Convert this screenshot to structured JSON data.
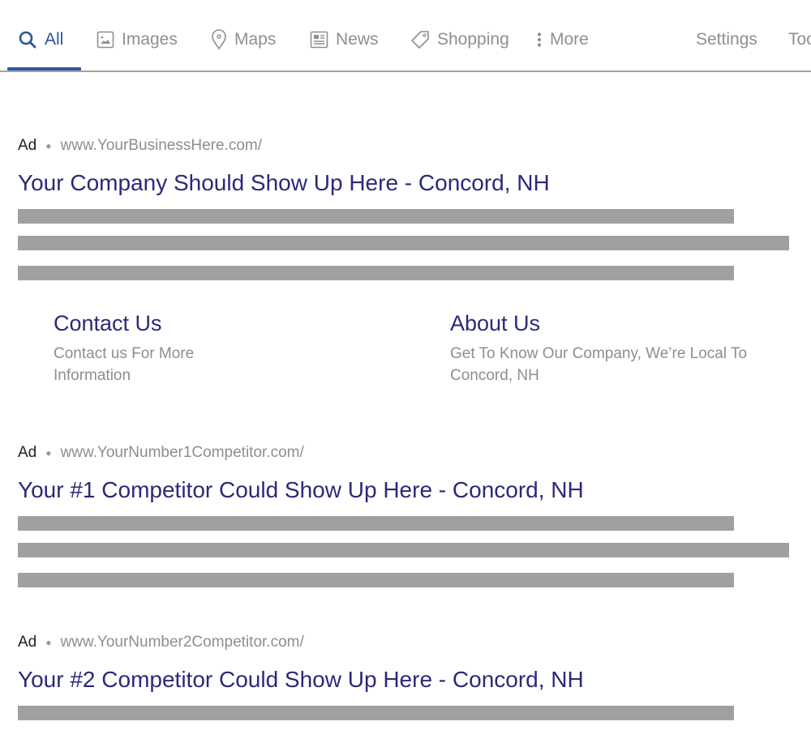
{
  "tabs": [
    {
      "id": "all",
      "label": "All",
      "icon": "search-icon",
      "active": true
    },
    {
      "id": "images",
      "label": "Images",
      "icon": "image-icon",
      "active": false
    },
    {
      "id": "maps",
      "label": "Maps",
      "icon": "map-pin-icon",
      "active": false
    },
    {
      "id": "news",
      "label": "News",
      "icon": "newspaper-icon",
      "active": false
    },
    {
      "id": "shopping",
      "label": "Shopping",
      "icon": "tag-icon",
      "active": false
    },
    {
      "id": "more",
      "label": "More",
      "icon": "more-vertical-icon",
      "active": false
    }
  ],
  "right_links": {
    "settings": "Settings",
    "tools": "Tools"
  },
  "colors": {
    "active_tab": "#2a5594",
    "ad_title": "#2a2a78",
    "placeholder_bar": "#a0a0a0",
    "muted_text": "#8e8e8e"
  },
  "ads": [
    {
      "badge": "Ad",
      "url": "www.YourBusinessHere.com/",
      "title": "Your Company Should Show Up Here - Concord, NH",
      "sitelinks": [
        {
          "title": "Contact Us",
          "description": "Contact us For More Information"
        },
        {
          "title": "About Us",
          "description": "Get To Know Our Company, We’re Local To Concord, NH"
        }
      ]
    },
    {
      "badge": "Ad",
      "url": "www.YourNumber1Competitor.com/",
      "title": "Your #1 Competitor Could Show Up Here - Concord, NH"
    },
    {
      "badge": "Ad",
      "url": "www.YourNumber2Competitor.com/",
      "title": "Your #2 Competitor Could Show Up Here - Concord, NH"
    }
  ]
}
